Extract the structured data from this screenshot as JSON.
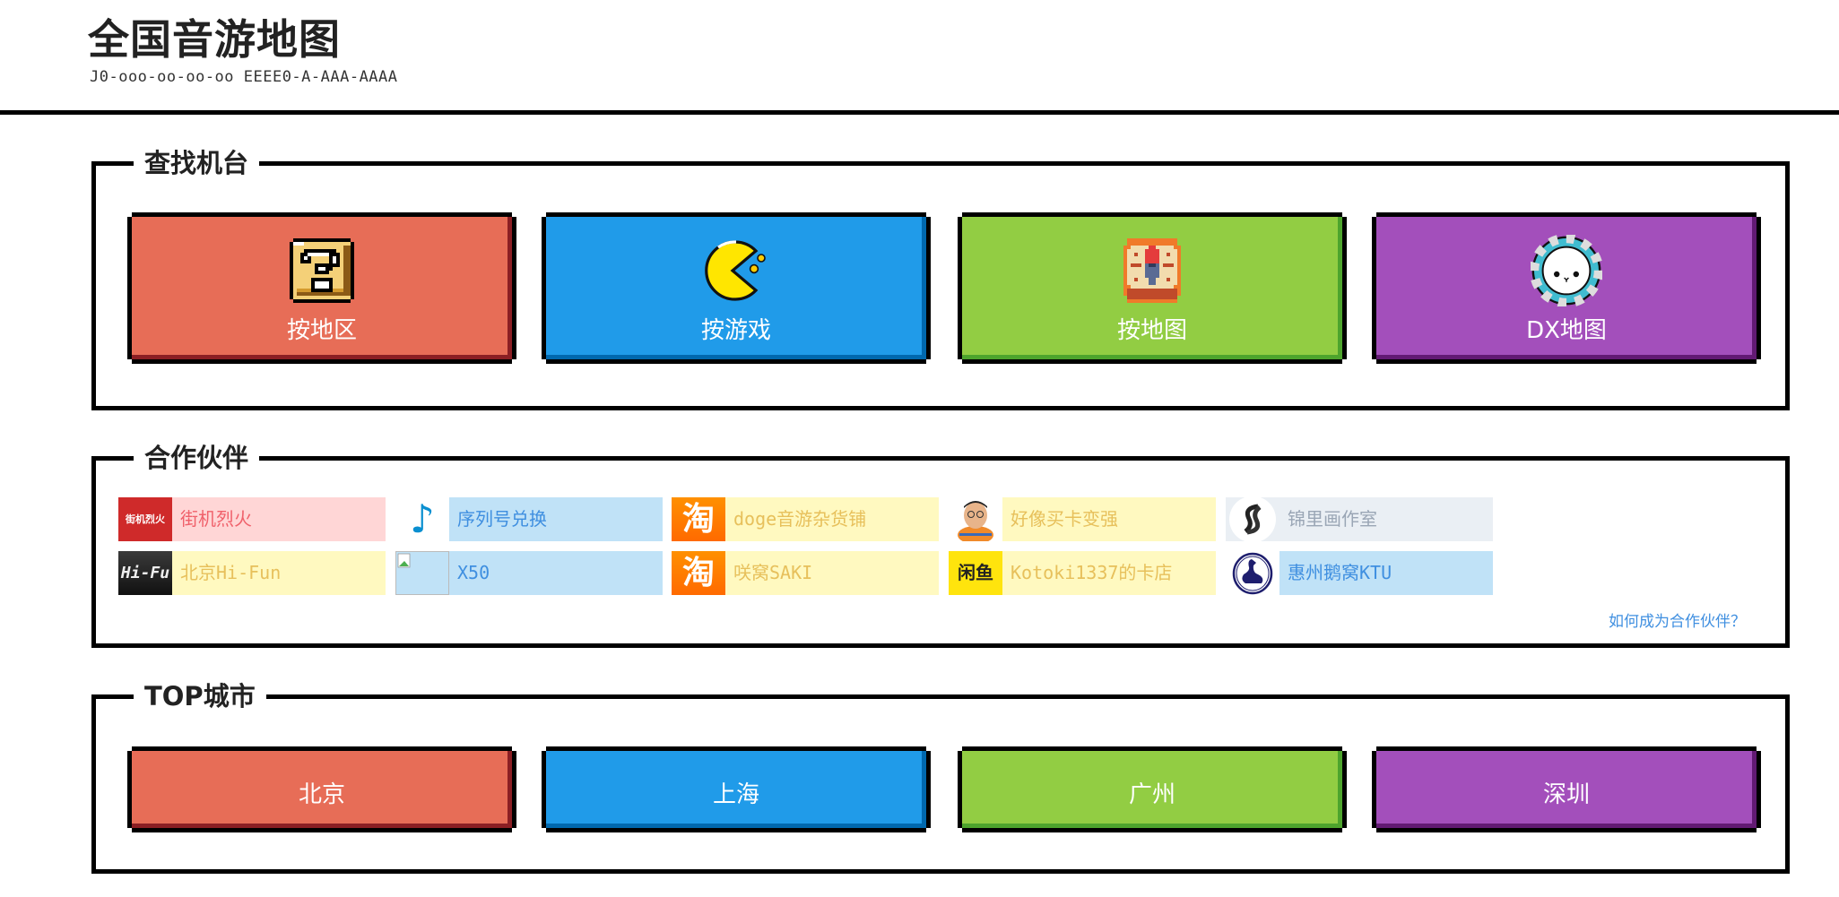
{
  "header": {
    "title": "全国音游地图",
    "subtitle": "J0-ooo-oo-oo-oo EEEE0-A-AAA-AAAA"
  },
  "find": {
    "legend": "查找机台",
    "cards": [
      {
        "label": "按地区",
        "icon": "question-block-icon",
        "color": "#e76d57"
      },
      {
        "label": "按游戏",
        "icon": "pacman-icon",
        "color": "#209be9"
      },
      {
        "label": "按地图",
        "icon": "compass-icon",
        "color": "#92cd43"
      },
      {
        "label": "DX地图",
        "icon": "maimai-bear-icon",
        "color": "#a34fbb"
      }
    ]
  },
  "partners": {
    "legend": "合作伙伴",
    "items": [
      {
        "name": "街机烈火",
        "logo": "街机烈火",
        "icon": "jiejilehuo-logo-icon"
      },
      {
        "name": "序列号兑换",
        "logo": "♪",
        "icon": "music-note-icon"
      },
      {
        "name": "doge音游杂货铺",
        "logo": "淘",
        "icon": "taobao-icon"
      },
      {
        "name": "好像买卡变强",
        "logo": "",
        "icon": "cartoon-man-avatar-icon"
      },
      {
        "name": "锦里画作室",
        "logo": "",
        "icon": "koi-fish-logo-icon"
      },
      {
        "name": "北京Hi-Fun",
        "logo": "Hi-Fu",
        "icon": "hifun-logo-icon"
      },
      {
        "name": "X50",
        "logo": "",
        "icon": "broken-image-icon"
      },
      {
        "name": "咲窝SAKI",
        "logo": "淘",
        "icon": "taobao-icon"
      },
      {
        "name": "Kotoki1337的卡店",
        "logo": "闲鱼",
        "icon": "xianyu-icon"
      },
      {
        "name": "惠州鹅窝KTU",
        "logo": "",
        "icon": "goose-logo-icon"
      }
    ],
    "join_link": "如何成为合作伙伴？"
  },
  "cities": {
    "legend": "TOP城市",
    "items": [
      {
        "label": "北京",
        "color": "#e76d57"
      },
      {
        "label": "上海",
        "color": "#209be9"
      },
      {
        "label": "广州",
        "color": "#92cd43"
      },
      {
        "label": "深圳",
        "color": "#a34fbb"
      }
    ]
  }
}
